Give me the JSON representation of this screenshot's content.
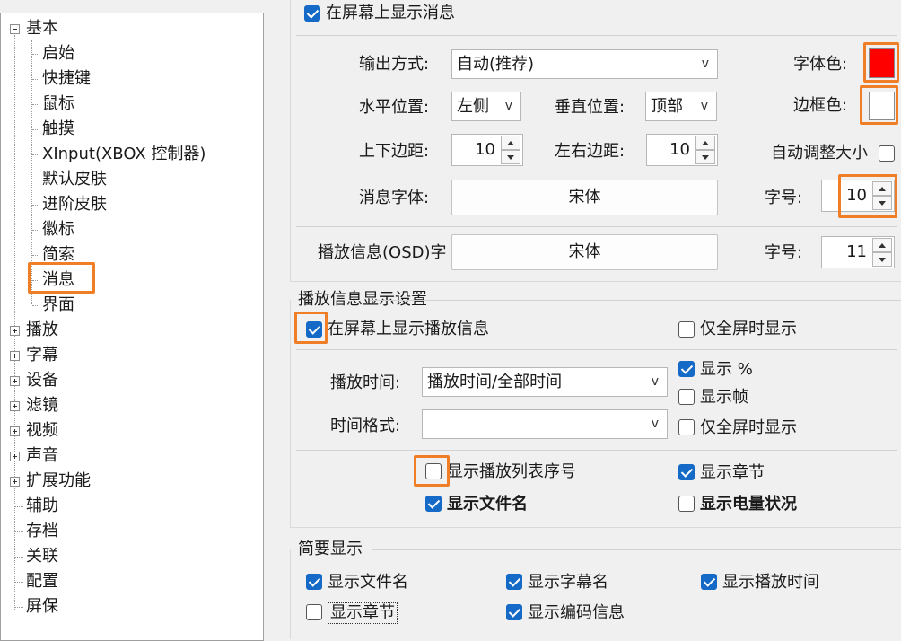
{
  "tree": {
    "root": "基本",
    "children": [
      "启始",
      "快捷键",
      "鼠标",
      "触摸",
      "XInput(XBOX 控制器)",
      "默认皮肤",
      "进阶皮肤",
      "徽标",
      "简索",
      "消息",
      "界面"
    ],
    "expandable": [
      "播放",
      "字幕",
      "设备",
      "滤镜",
      "视频",
      "声音",
      "扩展功能"
    ],
    "leaves": [
      "辅助",
      "存档",
      "关联",
      "配置",
      "屏保"
    ]
  },
  "osd": {
    "show_on_screen": "在屏幕上显示消息",
    "output_label": "输出方式:",
    "output_value": "自动(推荐)",
    "font_color_label": "字体色:",
    "font_color": "#ff0000",
    "border_color_label": "边框色:",
    "border_color": "#ffffff",
    "hpos_label": "水平位置:",
    "hpos_value": "左侧",
    "vpos_label": "垂直位置:",
    "vpos_value": "顶部",
    "vmargin_label": "上下边距:",
    "vmargin_value": "10",
    "hmargin_label": "左右边距:",
    "hmargin_value": "10",
    "autosize_label": "自动调整大小",
    "msg_font_label": "消息字体:",
    "msg_font_value": "宋体",
    "size_label": "字号:",
    "msg_size_value": "10",
    "play_font_label": "播放信息(OSD)字",
    "play_font_value": "宋体",
    "play_size_value": "11"
  },
  "playinfo": {
    "title": "播放信息显示设置",
    "show_play_info": "在屏幕上显示播放信息",
    "fullscreen_only": "仅全屏时显示",
    "time_label": "播放时间:",
    "time_value": "播放时间/全部时间",
    "show_percent": "显示 %",
    "show_frame": "显示帧",
    "format_label": "时间格式:",
    "format_value": "",
    "fullscreen_only2": "仅全屏时显示",
    "show_playlist_no": "显示播放列表序号",
    "show_chapter": "显示章节",
    "show_filename": "显示文件名",
    "show_battery": "显示电量状况"
  },
  "brief": {
    "title": "简要显示",
    "filename": "显示文件名",
    "subtitle_name": "显示字幕名",
    "play_time": "显示播放时间",
    "chapter": "显示章节",
    "codec": "显示编码信息"
  },
  "colors": {
    "accent": "#1569c7",
    "highlight": "#f07e26"
  }
}
